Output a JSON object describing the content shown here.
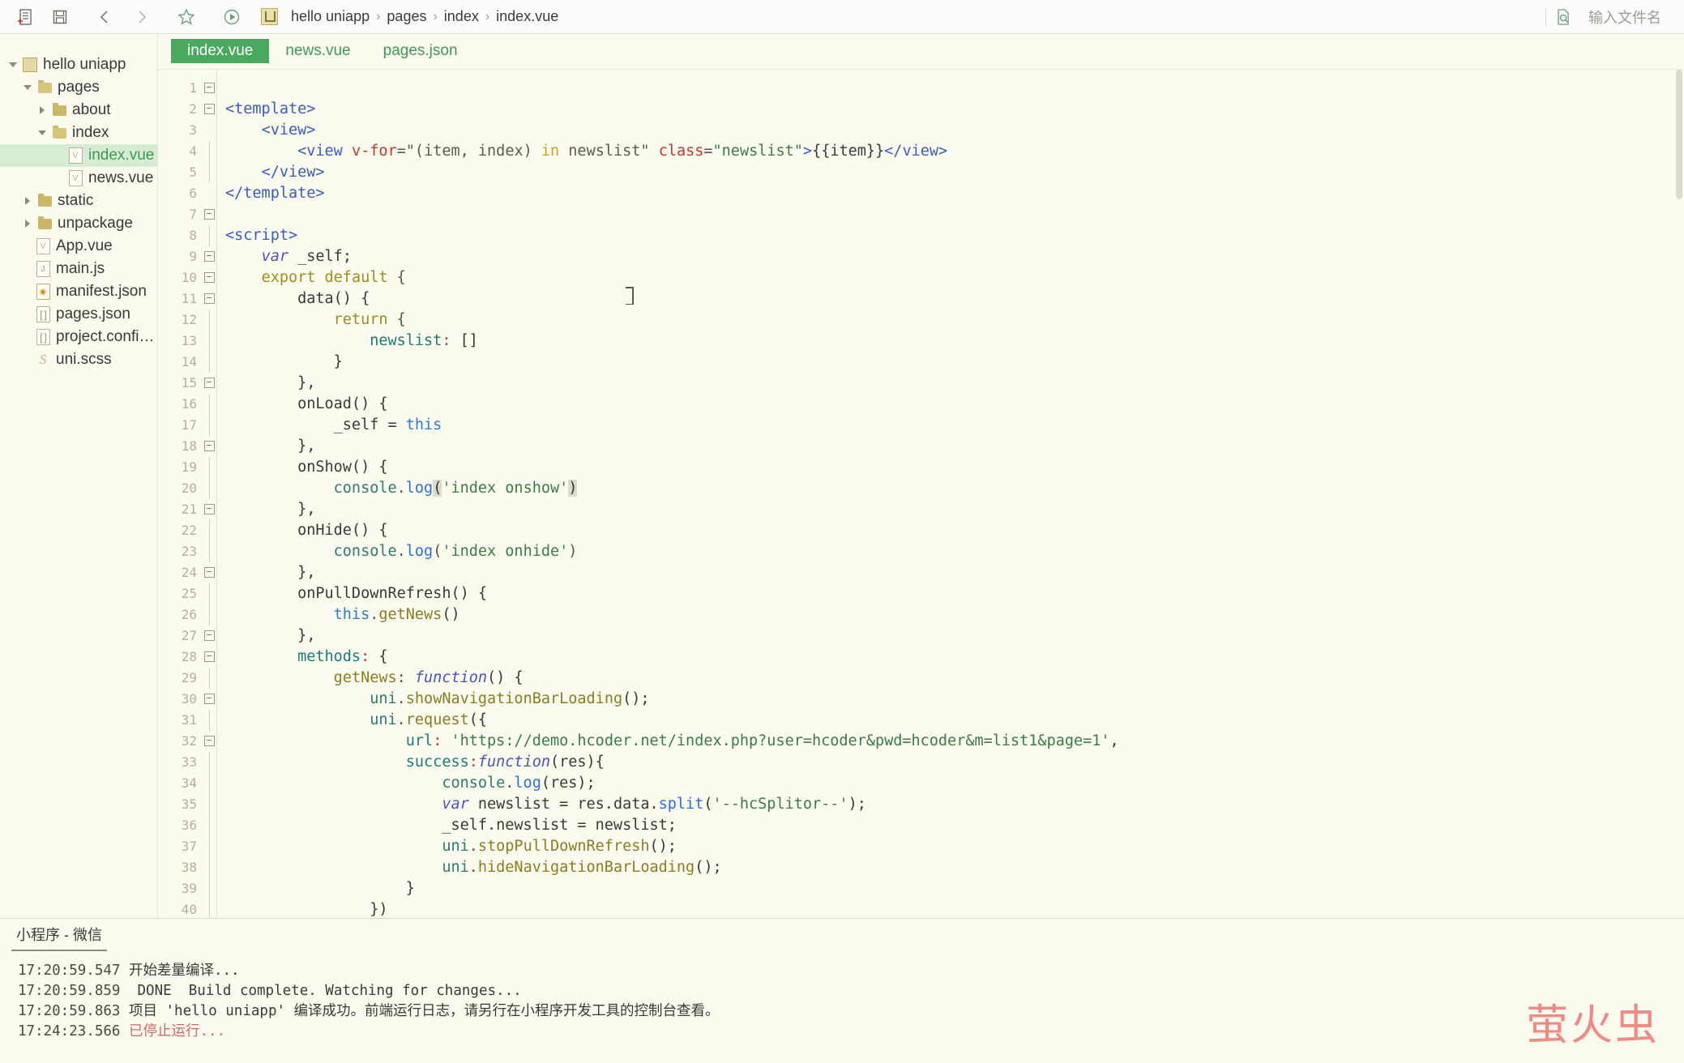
{
  "toolbar": {
    "icons": [
      {
        "name": "new-file-icon",
        "title": "新建"
      },
      {
        "name": "save-icon",
        "title": "保存"
      },
      {
        "name": "back-icon",
        "title": "后退"
      },
      {
        "name": "forward-icon",
        "title": "前进"
      },
      {
        "name": "bookmark-icon",
        "title": "收藏"
      },
      {
        "name": "run-icon",
        "title": "运行"
      }
    ],
    "breadcrumb": [
      "hello uniapp",
      "pages",
      "index",
      "index.vue"
    ],
    "breadcrumb_separator": "›",
    "search": {
      "icon": "file-search-icon",
      "placeholder": "输入文件名",
      "value": ""
    }
  },
  "sidebar": {
    "items": [
      {
        "label": "hello uniapp",
        "depth": 0,
        "twisty": "down",
        "icon": "project-icon",
        "selected": false
      },
      {
        "label": "pages",
        "depth": 1,
        "twisty": "down",
        "icon": "folder-open-icon",
        "selected": false
      },
      {
        "label": "about",
        "depth": 2,
        "twisty": "right",
        "icon": "folder-icon",
        "selected": false
      },
      {
        "label": "index",
        "depth": 2,
        "twisty": "down",
        "icon": "folder-open-icon",
        "selected": false
      },
      {
        "label": "index.vue",
        "depth": 3,
        "twisty": "none",
        "icon": "vue-file-icon",
        "selected": true
      },
      {
        "label": "news.vue",
        "depth": 3,
        "twisty": "none",
        "icon": "vue-file-icon",
        "selected": false
      },
      {
        "label": "static",
        "depth": 1,
        "twisty": "right",
        "icon": "folder-icon",
        "selected": false
      },
      {
        "label": "unpackage",
        "depth": 1,
        "twisty": "right",
        "icon": "folder-icon",
        "selected": false
      },
      {
        "label": "App.vue",
        "depth": 1,
        "twisty": "none",
        "icon": "vue-file-icon",
        "selected": false
      },
      {
        "label": "main.js",
        "depth": 1,
        "twisty": "none",
        "icon": "js-file-icon",
        "selected": false
      },
      {
        "label": "manifest.json",
        "depth": 1,
        "twisty": "none",
        "icon": "manifest-file-icon",
        "selected": false
      },
      {
        "label": "pages.json",
        "depth": 1,
        "twisty": "none",
        "icon": "json-file-icon",
        "selected": false
      },
      {
        "label": "project.config....",
        "depth": 1,
        "twisty": "none",
        "icon": "json-file-icon",
        "selected": false
      },
      {
        "label": "uni.scss",
        "depth": 1,
        "twisty": "none",
        "icon": "scss-file-icon",
        "selected": false
      }
    ]
  },
  "editor": {
    "tabs": [
      {
        "label": "index.vue",
        "active": true
      },
      {
        "label": "news.vue",
        "active": false
      },
      {
        "label": "pages.json",
        "active": false
      }
    ],
    "first_line": 1,
    "last_line": 40,
    "line_numbers": [
      1,
      2,
      3,
      4,
      5,
      6,
      7,
      8,
      9,
      10,
      11,
      12,
      13,
      14,
      15,
      16,
      17,
      18,
      19,
      20,
      21,
      22,
      23,
      24,
      25,
      26,
      27,
      28,
      29,
      30,
      31,
      32,
      33,
      34,
      35,
      36,
      37,
      38,
      39,
      40
    ],
    "fold_markers": [
      "box",
      "box",
      "",
      "bar",
      "bar",
      "",
      "box",
      "bar",
      "box",
      "box",
      "box",
      "bar",
      "bar",
      "bar",
      "box",
      "bar",
      "bar",
      "box",
      "bar",
      "bar",
      "box",
      "bar",
      "bar",
      "box",
      "bar",
      "bar",
      "box",
      "box",
      "bar",
      "box",
      "bar",
      "box",
      "bar",
      "bar",
      "bar",
      "bar",
      "bar",
      "bar",
      "bar",
      "bar"
    ],
    "lines": [
      "<template>",
      "    <view>",
      "        <view v-for=\"(item, index) in newslist\" class=\"newslist\">{{item}}</view>",
      "    </view>",
      "</template>",
      "",
      "<script>",
      "    var _self;",
      "    export default {",
      "        data() {",
      "            return {",
      "                newslist: []",
      "            }",
      "        },",
      "        onLoad() {",
      "            _self = this",
      "        },",
      "        onShow() {",
      "            console.log('index onshow')",
      "        },",
      "        onHide() {",
      "            console.log('index onhide')",
      "        },",
      "        onPullDownRefresh() {",
      "            this.getNews()",
      "        },",
      "        methods: {",
      "            getNews: function() {",
      "                uni.showNavigationBarLoading();",
      "                uni.request({",
      "                    url: 'https://demo.hcoder.net/index.php?user=hcoder&pwd=hcoder&m=list1&page=1',",
      "                    success:function(res){",
      "                        console.log(res);",
      "                        var newslist = res.data.split('--hcSplitor--');",
      "                        _self.newslist = newslist;",
      "                        uni.stopPullDownRefresh();",
      "                        uni.hideNavigationBarLoading();",
      "                    }",
      "                })",
      "            }"
    ]
  },
  "console": {
    "tab_label": "小程序 - 微信",
    "lines": [
      {
        "time": "17:20:59.547",
        "text": "开始差量编译...",
        "level": "info"
      },
      {
        "time": "17:20:59.859",
        "text": " DONE  Build complete. Watching for changes...",
        "level": "info"
      },
      {
        "time": "17:20:59.863",
        "text": "项目 'hello uniapp' 编译成功。前端运行日志，请另行在小程序开发工具的控制台查看。",
        "level": "info"
      },
      {
        "time": "17:24:23.566",
        "text": "已停止运行...",
        "level": "error"
      }
    ]
  },
  "watermark": {
    "text": "萤火虫",
    "color": "#f1807d"
  },
  "colors": {
    "accent_green": "#4aa95f",
    "background": "#fbfbef",
    "selection": "#d8ecd5",
    "error_red": "#d06666",
    "tag_blue": "#3b5bbd",
    "attr_red": "#c0392b",
    "string_green": "#3d7a4a",
    "keyword_olive": "#9a8f1e"
  }
}
